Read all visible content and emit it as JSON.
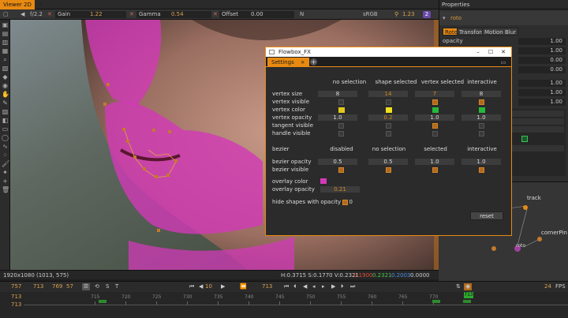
{
  "viewer": {
    "tab_label": "Viewer 2D",
    "tab_close": "×",
    "toolbar": {
      "aperture": "f/2.2",
      "gain_label": "Gain",
      "gain_value": "1.22",
      "gamma_label": "Gamma",
      "gamma_value": "0.54",
      "offset_label": "Offset",
      "offset_value": "0.00",
      "channel": "N",
      "colorspace": "sRGB",
      "zoom": "1.23",
      "badge": "2"
    },
    "status": {
      "resolution": "1920x1080",
      "cursor": "(1013, 575)",
      "hsv": "H:0.3715 S:0.1770 V:0.2321",
      "rgb_r": "0.1900",
      "rgb_g": "0.2321",
      "rgb_b": "0.2003",
      "alpha": "0.0000"
    }
  },
  "properties": {
    "header": "Properties",
    "node_name": "roto",
    "tabs": [
      "Roto",
      "Transform",
      "Motion Blur"
    ],
    "opacity_label": "opacity",
    "values": [
      "1.00",
      "1.00",
      "0.00",
      "0.00",
      "1.00",
      "1.00",
      "1.00"
    ]
  },
  "nodegraph": {
    "track_label": "track",
    "cornerpin_label": "cornerPin",
    "roto_label": "roto"
  },
  "fx_window": {
    "title": "Flowbox_FX",
    "tab": "Settings",
    "columns_a": [
      "no selection",
      "shape selected",
      "vertex selected",
      "interactive"
    ],
    "rows_a": {
      "vertex_size_label": "vertex size",
      "vertex_size": [
        "8",
        "14",
        "7",
        "8"
      ],
      "vertex_visible_label": "vertex visible",
      "vertex_color_label": "vertex color",
      "vertex_colors": [
        "#e2c81c",
        "#f0e020",
        "#27b83a",
        "#27b83a"
      ],
      "vertex_opacity_label": "vertex opacity",
      "vertex_opacity": [
        "1.0",
        "0.2",
        "1.0",
        "1.0"
      ],
      "tangent_visible_label": "tangent visible",
      "handle_visible_label": "handle visible"
    },
    "columns_b": [
      "disabled",
      "no selection",
      "selected",
      "interactive"
    ],
    "bezier_label": "bezier",
    "rows_b": {
      "bezier_opacity_label": "bezier opacity",
      "bezier_opacity": [
        "0.5",
        "0.5",
        "1.0",
        "1.0"
      ],
      "bezier_visible_label": "bezier visible"
    },
    "overlay_color_label": "overlay color",
    "overlay_color": "#d23ab8",
    "overlay_opacity_label": "overlay opacity",
    "overlay_opacity": "0.21",
    "hide_shapes_label": "hide shapes with opacity = 0",
    "reset_label": "reset"
  },
  "timeline": {
    "start": "757",
    "in": "713",
    "frame_a": "769",
    "frame_b": "57",
    "step": "10",
    "current": "713",
    "fps_label": "FPS",
    "fps": "24",
    "end": "713",
    "ruler_labels": [
      "715",
      "720",
      "725",
      "730",
      "735",
      "740",
      "745",
      "750",
      "755",
      "760",
      "765",
      "770"
    ]
  },
  "colors": {
    "accent": "#e88a12",
    "overlay": "#d23ab8"
  }
}
